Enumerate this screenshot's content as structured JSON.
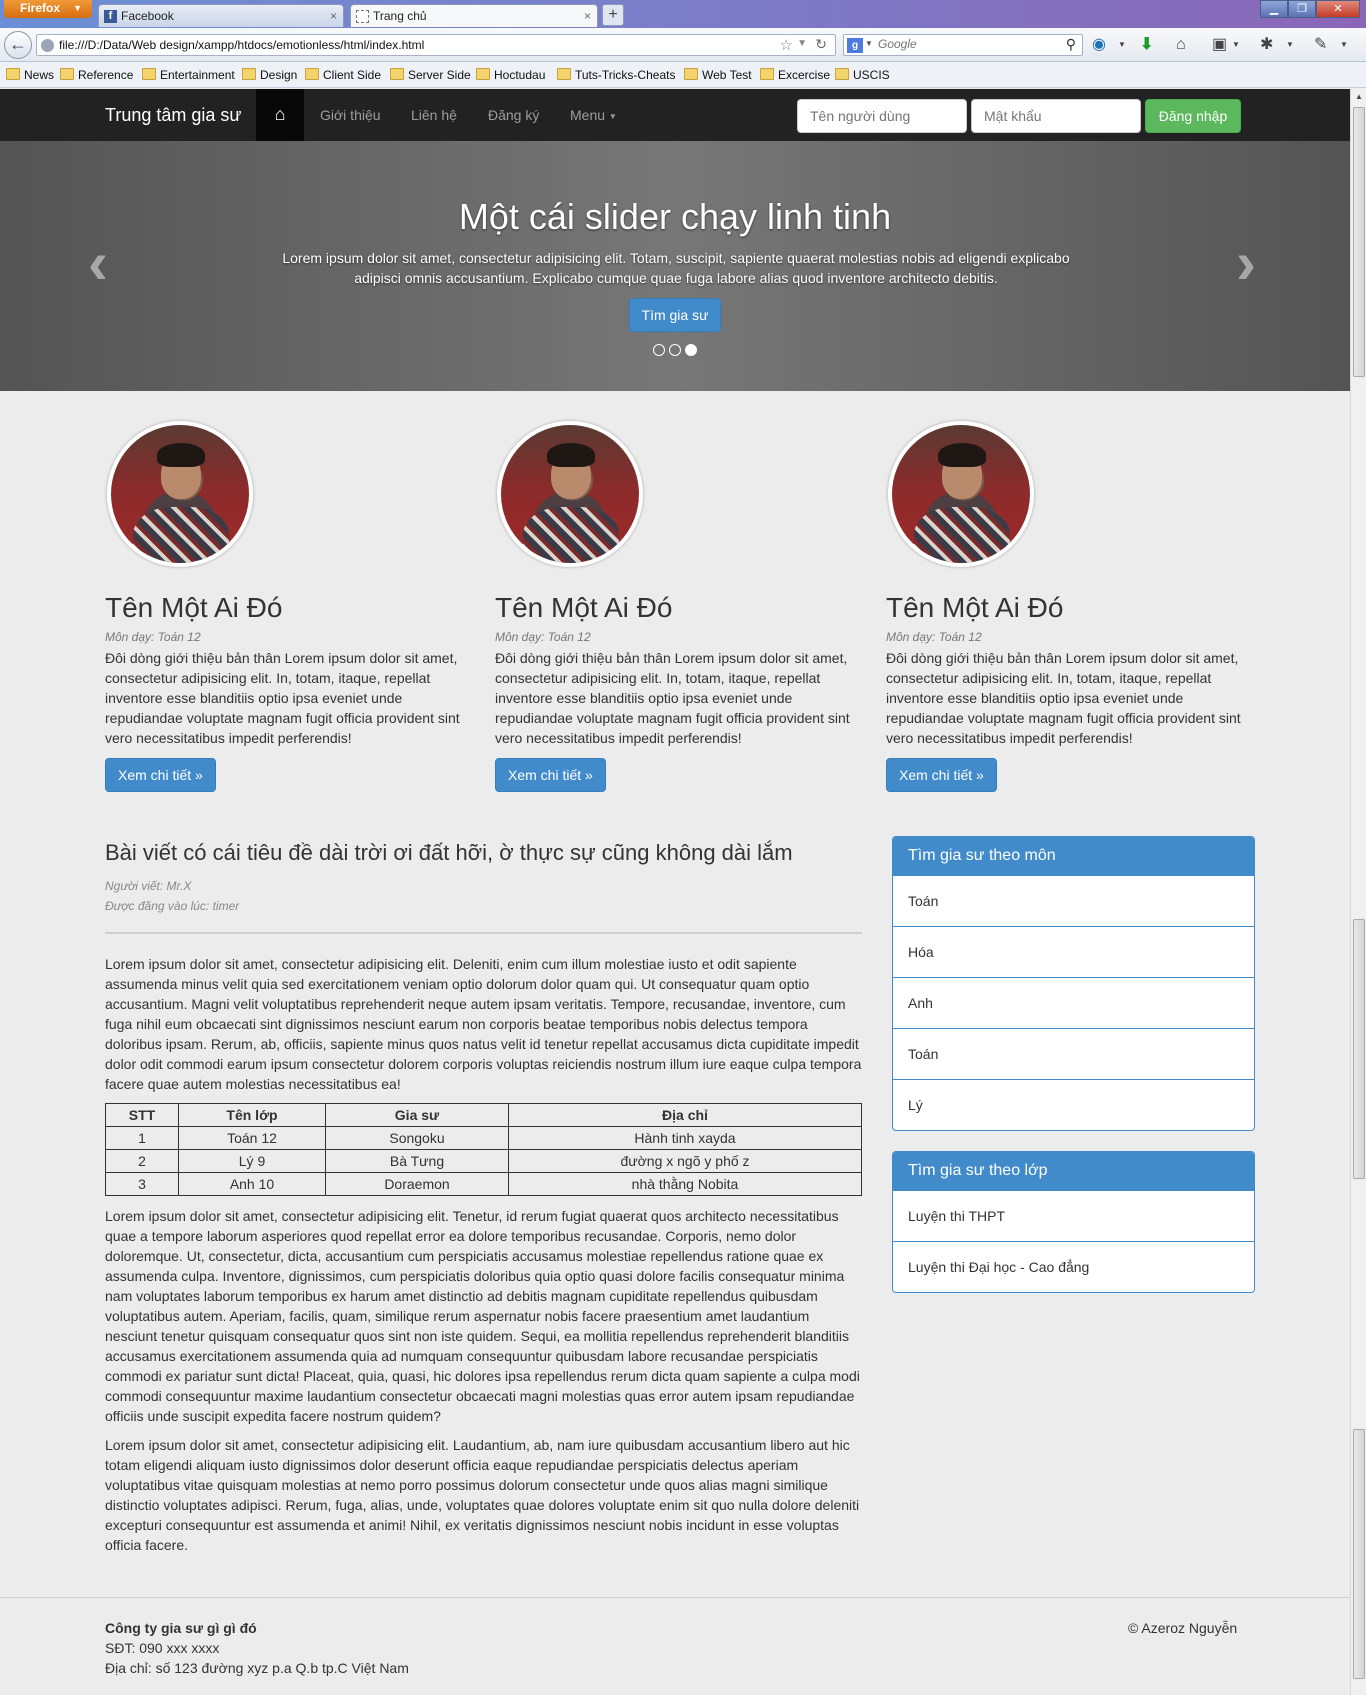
{
  "browser": {
    "menu_label": "Firefox",
    "tabs": [
      {
        "label": "Facebook"
      },
      {
        "label": "Trang chủ"
      }
    ],
    "url": "file:///D:/Data/Web design/xampp/htdocs/emotionless/html/index.html",
    "search_placeholder": "Google",
    "bookmarks": [
      "News",
      "Reference",
      "Entertainment",
      "Design",
      "Client Side",
      "Server Side",
      "Hoctudau",
      "Tuts-Tricks-Cheats",
      "Web Test",
      "Excercise",
      "USCIS"
    ]
  },
  "nav": {
    "brand": "Trung tâm gia sư",
    "links": [
      "Giới thiệu",
      "Liên hệ",
      "Đăng ký",
      "Menu"
    ],
    "username_placeholder": "Tên người dùng",
    "password_placeholder": "Mật khẩu",
    "login_label": "Đăng nhập"
  },
  "carousel": {
    "title": "Một cái slider chạy linh tinh",
    "text": "Lorem ipsum dolor sit amet, consectetur adipisicing elit. Totam, suscipit, sapiente quaerat molestias nobis ad eligendi explicabo adipisci omnis accusantium. Explicabo cumque quae fuga labore alias quod inventore architecto debitis.",
    "button": "Tìm gia sư",
    "active_slide": 3,
    "total_slides": 3
  },
  "tutors": [
    {
      "name": "Tên Một Ai Đó",
      "subject": "Môn dạy: Toán 12",
      "desc": "Đôi dòng giới thiệu bản thân Lorem ipsum dolor sit amet, consectetur adipisicing elit. In, totam, itaque, repellat inventore esse blanditiis optio ipsa eveniet unde repudiandae voluptate magnam fugit officia provident sint vero necessitatibus impedit perferendis!",
      "button": "Xem chi tiết »"
    },
    {
      "name": "Tên Một Ai Đó",
      "subject": "Môn dạy: Toán 12",
      "desc": "Đôi dòng giới thiệu bản thân Lorem ipsum dolor sit amet, consectetur adipisicing elit. In, totam, itaque, repellat inventore esse blanditiis optio ipsa eveniet unde repudiandae voluptate magnam fugit officia provident sint vero necessitatibus impedit perferendis!",
      "button": "Xem chi tiết »"
    },
    {
      "name": "Tên Một Ai Đó",
      "subject": "Môn dạy: Toán 12",
      "desc": "Đôi dòng giới thiệu bản thân Lorem ipsum dolor sit amet, consectetur adipisicing elit. In, totam, itaque, repellat inventore esse blanditiis optio ipsa eveniet unde repudiandae voluptate magnam fugit officia provident sint vero necessitatibus impedit perferendis!",
      "button": "Xem chi tiết »"
    }
  ],
  "article": {
    "title": "Bài viết có cái tiêu đề dài trời ơi đất hỡi, ờ thực sự cũng không dài lắm",
    "author": "Người viết: Mr.X",
    "posted": "Được đăng vào lúc: timer",
    "p1": "Lorem ipsum dolor sit amet, consectetur adipisicing elit. Deleniti, enim cum illum molestiae iusto et odit sapiente assumenda minus velit quia sed exercitationem veniam optio dolorum dolor quam qui. Ut consequatur quam optio accusantium. Magni velit voluptatibus reprehenderit neque autem ipsam veritatis. Tempore, recusandae, inventore, cum fuga nihil eum obcaecati sint dignissimos nesciunt earum non corporis beatae temporibus nobis delectus tempora doloribus ipsam. Rerum, ab, officiis, sapiente minus quos natus velit id tenetur repellat accusamus dicta cupiditate impedit dolor odit commodi earum ipsum consectetur dolorem corporis voluptas reiciendis nostrum illum iure eaque culpa tempora facere quae autem molestias necessitatibus ea!",
    "table": {
      "headers": [
        "STT",
        "Tên lớp",
        "Gia sư",
        "Địa chỉ"
      ],
      "rows": [
        [
          "1",
          "Toán 12",
          "Songoku",
          "Hành tinh xayda"
        ],
        [
          "2",
          "Lý 9",
          "Bà Tưng",
          "đường x ngõ y phố z"
        ],
        [
          "3",
          "Anh 10",
          "Doraemon",
          "nhà thằng Nobita"
        ]
      ]
    },
    "p2": "Lorem ipsum dolor sit amet, consectetur adipisicing elit. Tenetur, id rerum fugiat quaerat quos architecto necessitatibus quae a tempore laborum asperiores quod repellat error ea dolore temporibus recusandae. Corporis, nemo dolor doloremque. Ut, consectetur, dicta, accusantium cum perspiciatis accusamus molestiae repellendus ratione quae ex assumenda culpa. Inventore, dignissimos, cum perspiciatis doloribus quia optio quasi dolore facilis consequatur minima nam voluptates laborum temporibus ex harum amet distinctio ad debitis magnam cupiditate repellendus quibusdam voluptatibus autem. Aperiam, facilis, quam, similique rerum aspernatur nobis facere praesentium amet laudantium nesciunt tenetur quisquam consequatur quos sint non iste quidem. Sequi, ea mollitia repellendus reprehenderit blanditiis accusamus exercitationem assumenda quia ad numquam consequuntur quibusdam labore recusandae perspiciatis commodi ex pariatur sunt dicta! Placeat, quia, quasi, hic dolores ipsa repellendus rerum dicta quam sapiente a culpa modi commodi consequuntur maxime laudantium consectetur obcaecati magni molestias quas error autem ipsam repudiandae officiis unde suscipit expedita facere nostrum quidem?",
    "p3": "Lorem ipsum dolor sit amet, consectetur adipisicing elit. Laudantium, ab, nam iure quibusdam accusantium libero aut hic totam eligendi aliquam iusto dignissimos dolor deserunt officia eaque repudiandae perspiciatis delectus aperiam voluptatibus vitae quisquam molestias at nemo porro possimus dolorum consectetur unde quos alias magni similique distinctio voluptates adipisci. Rerum, fuga, alias, unde, voluptates quae dolores voluptate enim sit quo nulla dolore deleniti excepturi consequuntur est assumenda et animi! Nihil, ex veritatis dignissimos nesciunt nobis incidunt in esse voluptas officia facere."
  },
  "sidebar": {
    "subject_panel": {
      "title": "Tìm gia sư theo môn",
      "items": [
        "Toán",
        "Hóa",
        "Anh",
        "Toán",
        "Lý"
      ]
    },
    "level_panel": {
      "title": "Tìm gia sư theo lớp",
      "items": [
        "Luyện thi THPT",
        "Luyện thi Đại học - Cao đẳng"
      ]
    }
  },
  "footer": {
    "company": "Công ty gia sư gì gì đó",
    "phone": "SĐT: 090 xxx xxxx",
    "address": "Địa chỉ: số 123 đường xyz p.a Q.b tp.C Việt Nam",
    "copyright": "© Azeroz Nguyễn"
  },
  "colors": {
    "primary": "#428bca",
    "success": "#5cb85c",
    "navbar": "#222222"
  }
}
